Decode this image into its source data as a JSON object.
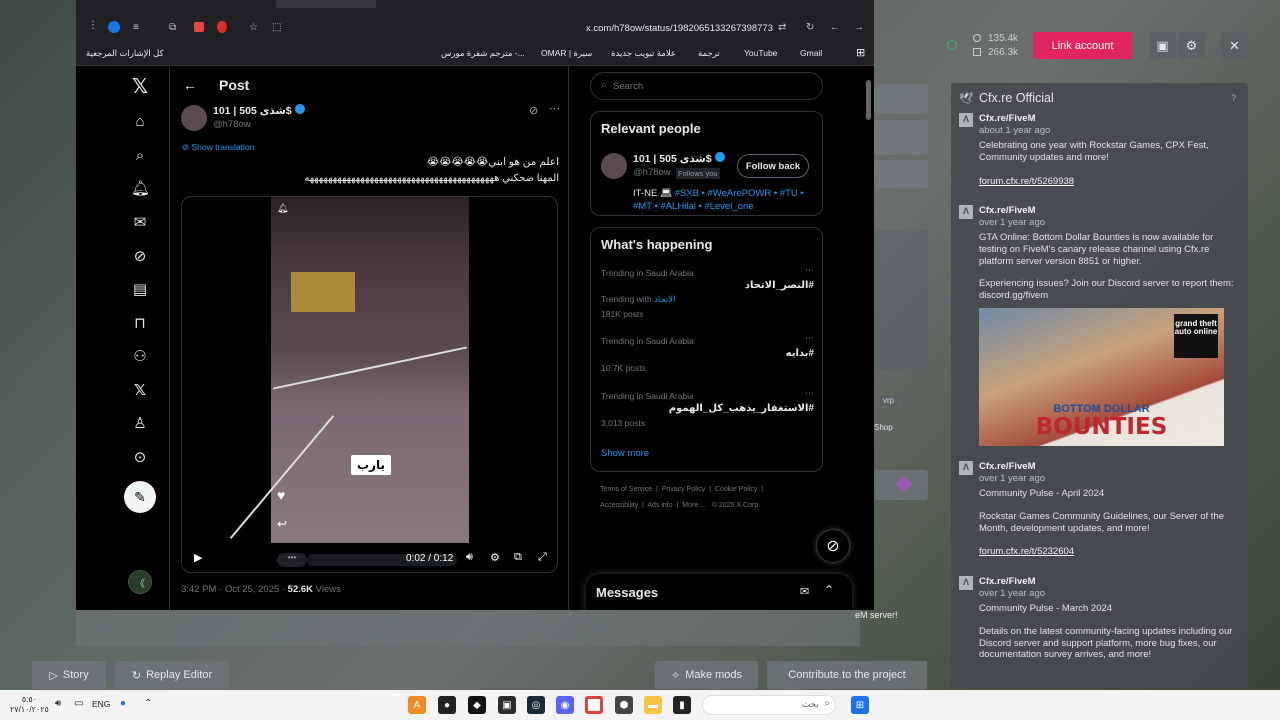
{
  "fivem": {
    "stats": [
      "135.4k",
      "266.3k"
    ],
    "link_account": "Link account",
    "feed_title": "Cfx.re Official",
    "feed_help": "?",
    "items": [
      {
        "author": "Cfx.re/FiveM",
        "time": "about 1 year ago",
        "lines": [
          "Celebrating one year with Rockstar Games, CPX Fest, Community updates and more!"
        ],
        "link": "forum.cfx.re/t/5269938"
      },
      {
        "author": "Cfx.re/FiveM",
        "time": "over 1 year ago",
        "lines": [
          "GTA Online: Bottom Dollar Bounties is now available for testing on FiveM's canary release channel using Cfx.re platform server version 8851 or higher.",
          "Experiencing issues? Join our Discord server to report them: discord.gg/fivem"
        ]
      },
      {
        "author": "Cfx.re/FiveM",
        "time": "over 1 year ago",
        "lines": [
          "Community Pulse - April 2024",
          "Rockstar Games Community Guidelines, our Server of the Month, development updates, and more!"
        ],
        "link": "forum.cfx.re/t/5232604"
      },
      {
        "author": "Cfx.re/FiveM",
        "time": "over 1 year ago",
        "lines": [
          "Community Pulse - March 2024",
          "Details on the latest community-facing updates including our Discord server and support platform, more bug fixes, our documentation survey arrives, and more!"
        ]
      }
    ],
    "banner": {
      "line1": "BOTTOM DOLLAR",
      "line2": "BOUNTIES",
      "logo": "grand theft auto online"
    },
    "side_labels": {
      "vrp": "vrp",
      "shop": "Shop",
      "server": "eM server!"
    },
    "bottom": {
      "story": "Story",
      "replay": "Replay Editor",
      "make_mods": "Make mods",
      "contribute": "Contribute to the project"
    }
  },
  "browser": {
    "url": "x.com/h78ow/status/1982065133267398773",
    "bookmarks": [
      "كل الإشارات المرجعية",
      "مترجم شفرة مورس -...",
      "OMAR | سيرة",
      "علامة تبويب جديدة",
      "ترجمة",
      "YouTube",
      "Gmail"
    ]
  },
  "x": {
    "header": "Post",
    "author_name": "101 | 505 شذى$",
    "handle": "@h78ow",
    "show_translation": "Show translation",
    "tweet_line1": "اعلم من هو ابني😭😭😭😭😭",
    "tweet_line2": "المهنا ضحكني هههههههههههههههههههههههههههههههههههههههههه",
    "video_caption": "يارب",
    "video_time": "0:02 / 0:12",
    "post_time": "3:42 PM · Oct 25, 2025 · ",
    "views_num": "52.6K",
    "views_label": " Views",
    "search_placeholder": "Search",
    "relevant_title": "Relevant people",
    "rp_name": "101 | 505 شذى$",
    "rp_handle": "@h78ow",
    "follows_you": "Follows you",
    "follow_back": "Follow back",
    "bio_prefix": "IT-NE",
    "bio_tags": "#SXB • #WeArePOWR • #TU • #MT • #ALHilal • #Level_one",
    "happening_title": "What's happening",
    "trends": [
      {
        "meta": "Trending in Saudi Arabia",
        "name": "#النصر_الاتحاد",
        "extra_label": "Trending with ",
        "extra_tag": "الاتحاد",
        "posts": "181K posts"
      },
      {
        "meta": "Trending in Saudi Arabia",
        "name": "#بدايه",
        "posts": "10.7K posts"
      },
      {
        "meta": "Trending in Saudi Arabia",
        "name": "#الاستغفار_يذهب_كل_الهموم",
        "posts": "3,013 posts"
      }
    ],
    "show_more": "Show more",
    "footer1": [
      "Terms of Service",
      "Privacy Policy",
      "Cookie Policy"
    ],
    "footer2": [
      "Accessibility",
      "Ads info",
      "More ...",
      "© 2025 X Corp."
    ],
    "messages": "Messages"
  },
  "taskbar": {
    "lang": "ENG",
    "search_placeholder": "بحث",
    "time": "٥:٥٠",
    "date": "٢٧/١٠/٢٠٢٥"
  },
  "icons": [
    "x-logo-icon",
    "home-icon",
    "search-icon",
    "notifications-icon",
    "messages-icon",
    "grok-icon",
    "lists-icon",
    "bookmarks-icon",
    "communities-icon",
    "premium-icon",
    "profile-icon",
    "more-icon",
    "post-compose-icon"
  ]
}
